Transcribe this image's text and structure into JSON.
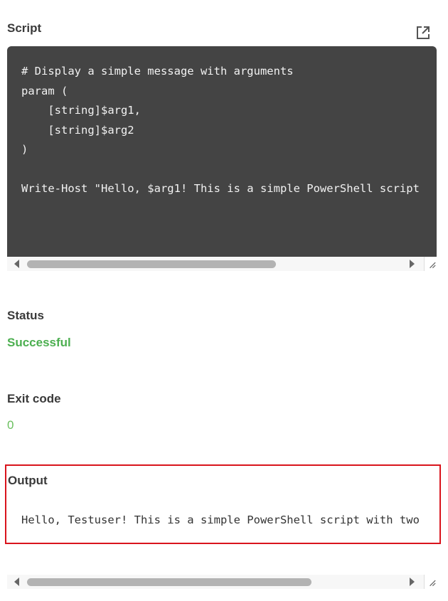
{
  "script": {
    "label": "Script",
    "code": "# Display a simple message with arguments\nparam (\n    [string]$arg1,\n    [string]$arg2\n)\n\nWrite-Host \"Hello, $arg1! This is a simple PowerShell script",
    "open_icon": "external-link-icon"
  },
  "status": {
    "label": "Status",
    "value": "Successful",
    "color": "#4caf50"
  },
  "exit_code": {
    "label": "Exit code",
    "value": "0"
  },
  "output": {
    "label": "Output",
    "text": "Hello, Testuser! This is a simple PowerShell script with two",
    "highlight_color": "#d9141c"
  }
}
